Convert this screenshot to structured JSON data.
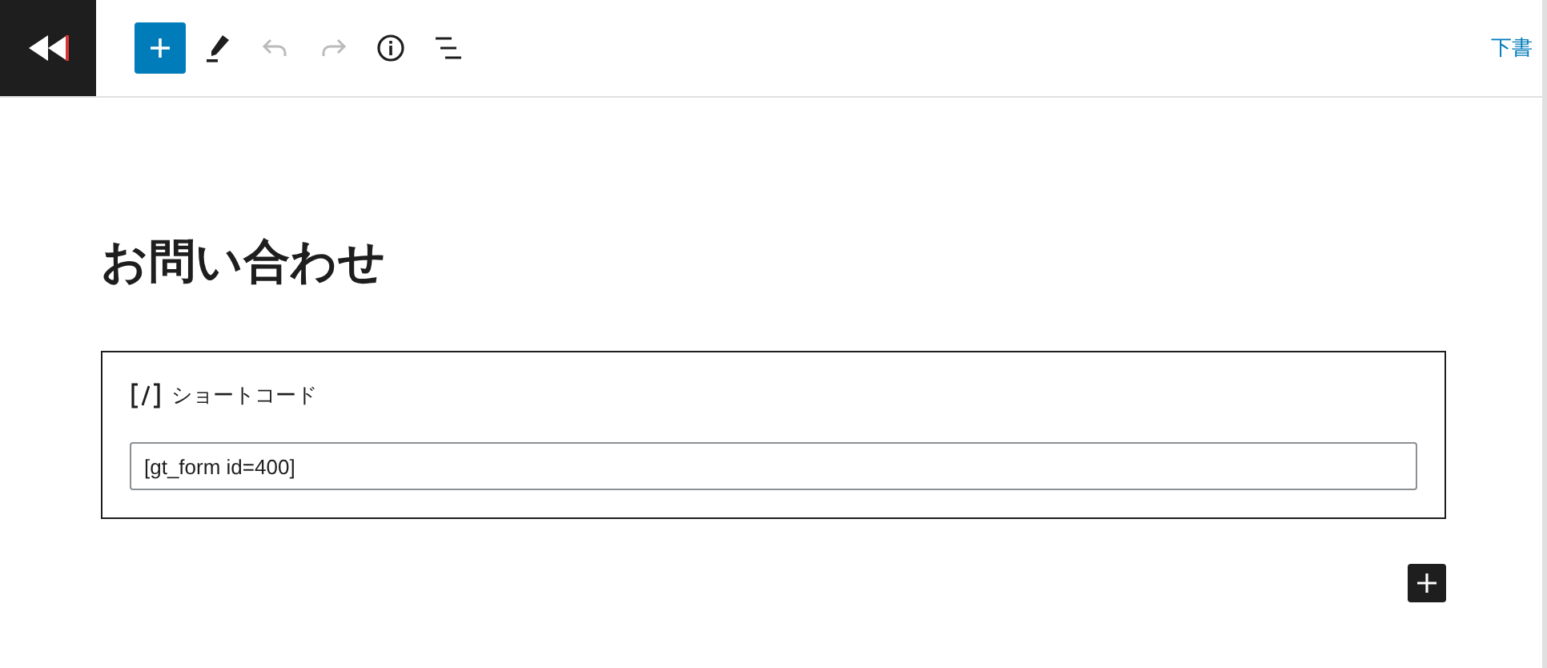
{
  "toolbar": [
    {
      "kind": "inserter",
      "disabled": false
    },
    {
      "kind": "tools",
      "disabled": false
    },
    {
      "kind": "undo",
      "disabled": true
    },
    {
      "kind": "redo",
      "disabled": true
    },
    {
      "kind": "info",
      "disabled": false
    },
    {
      "kind": "outline",
      "disabled": false
    }
  ],
  "save_draft": "下書",
  "post_title": "お問い合わせ",
  "block": {
    "label": "ショートコード",
    "value": "[gt_form id=400]"
  }
}
